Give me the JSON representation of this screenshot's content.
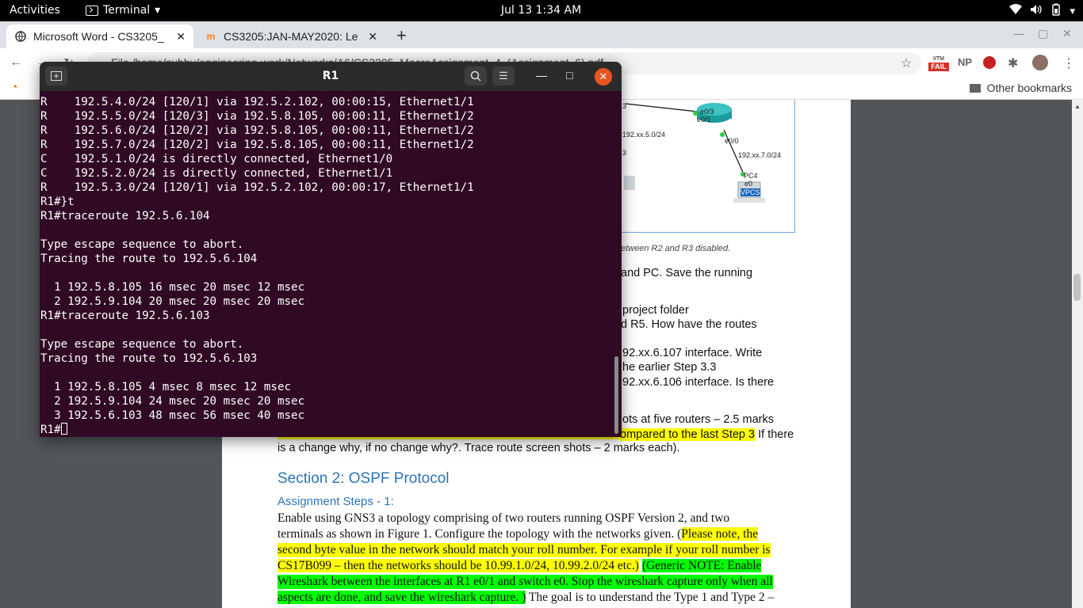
{
  "topbar": {
    "activities": "Activities",
    "app": "Terminal",
    "clock": "Jul 13  1:34 AM"
  },
  "browser": {
    "tabs": [
      {
        "label": "Microsoft Word - CS3205_",
        "active": true
      },
      {
        "label": "CS3205:JAN-MAY2020: Le",
        "active": false
      }
    ],
    "address": "File  /home/subbu/engineering-work/Networks/A6/CS3205_MacroAssignment_4_(Assignment_6).pdf",
    "ext_fail_top": "IITM",
    "ext_fail": "FAIL",
    "ext_np": "NP",
    "other_bookmarks": "Other bookmarks"
  },
  "pdf": {
    "net_labels": [
      "192.xx.5.0/24",
      "e0/3",
      "e0/1",
      "e0/0",
      "192.xx.7.0/24",
      "PC4",
      "e0",
      "VPCS",
      "0/1",
      "3"
    ],
    "caption": "etween R2 and R3 disabled.",
    "frag1": "and PC. Save the running",
    "frag2": "project folder",
    "frag3": "d R5. How have the routes",
    "frag4": "92.xx.6.107 interface. Write",
    "frag5": "he earlier Step 3.3",
    "frag6": "92.xx.6.106 interface. Is there",
    "frag7": "ots at five routers – 2.5 marks",
    "frag8a": "ompared to the last Step 3",
    "frag8b": " If there",
    "frag9": "is a change why, if no change why?. Trace route screen shots – 2 marks each).",
    "section": "Section 2: OSPF Protocol",
    "subsection": "Assignment Steps - 1:",
    "para": [
      "Enable using GNS3 a topology comprising of two routers running OSPF Version 2, and two",
      "terminals as shown in Figure 1. Configure the topology with the networks given. (",
      "Please note, the",
      "second byte value in the network should match your roll number. For example if your roll number is",
      "CS17B099 – then the networks should be 10.99.1.0/24, 10.99.2.0/24 etc.)",
      "(Generic NOTE: Enable",
      "Wireshark between the interfaces at R1 e0/1 and switch e0. Stop the wireshark capture only when all",
      "aspects are done, and save the wireshark capture. )",
      " The goal is to understand the Type 1 and Type 2 –"
    ]
  },
  "terminal": {
    "title": "R1",
    "lines": [
      "R    192.5.4.0/24 [120/1] via 192.5.2.102, 00:00:15, Ethernet1/1",
      "R    192.5.5.0/24 [120/3] via 192.5.8.105, 00:00:11, Ethernet1/2",
      "R    192.5.6.0/24 [120/2] via 192.5.8.105, 00:00:11, Ethernet1/2",
      "R    192.5.7.0/24 [120/2] via 192.5.8.105, 00:00:11, Ethernet1/2",
      "C    192.5.1.0/24 is directly connected, Ethernet1/0",
      "C    192.5.2.0/24 is directly connected, Ethernet1/1",
      "R    192.5.3.0/24 [120/1] via 192.5.2.102, 00:00:17, Ethernet1/1",
      "R1#}t",
      "R1#traceroute 192.5.6.104",
      "",
      "Type escape sequence to abort.",
      "Tracing the route to 192.5.6.104",
      "",
      "  1 192.5.8.105 16 msec 20 msec 12 msec",
      "  2 192.5.9.104 20 msec 20 msec 20 msec",
      "R1#traceroute 192.5.6.103",
      "",
      "Type escape sequence to abort.",
      "Tracing the route to 192.5.6.103",
      "",
      "  1 192.5.8.105 4 msec 8 msec 12 msec",
      "  2 192.5.9.104 24 msec 20 msec 20 msec",
      "  3 192.5.6.103 48 msec 56 msec 40 msec"
    ],
    "prompt": "R1#"
  }
}
